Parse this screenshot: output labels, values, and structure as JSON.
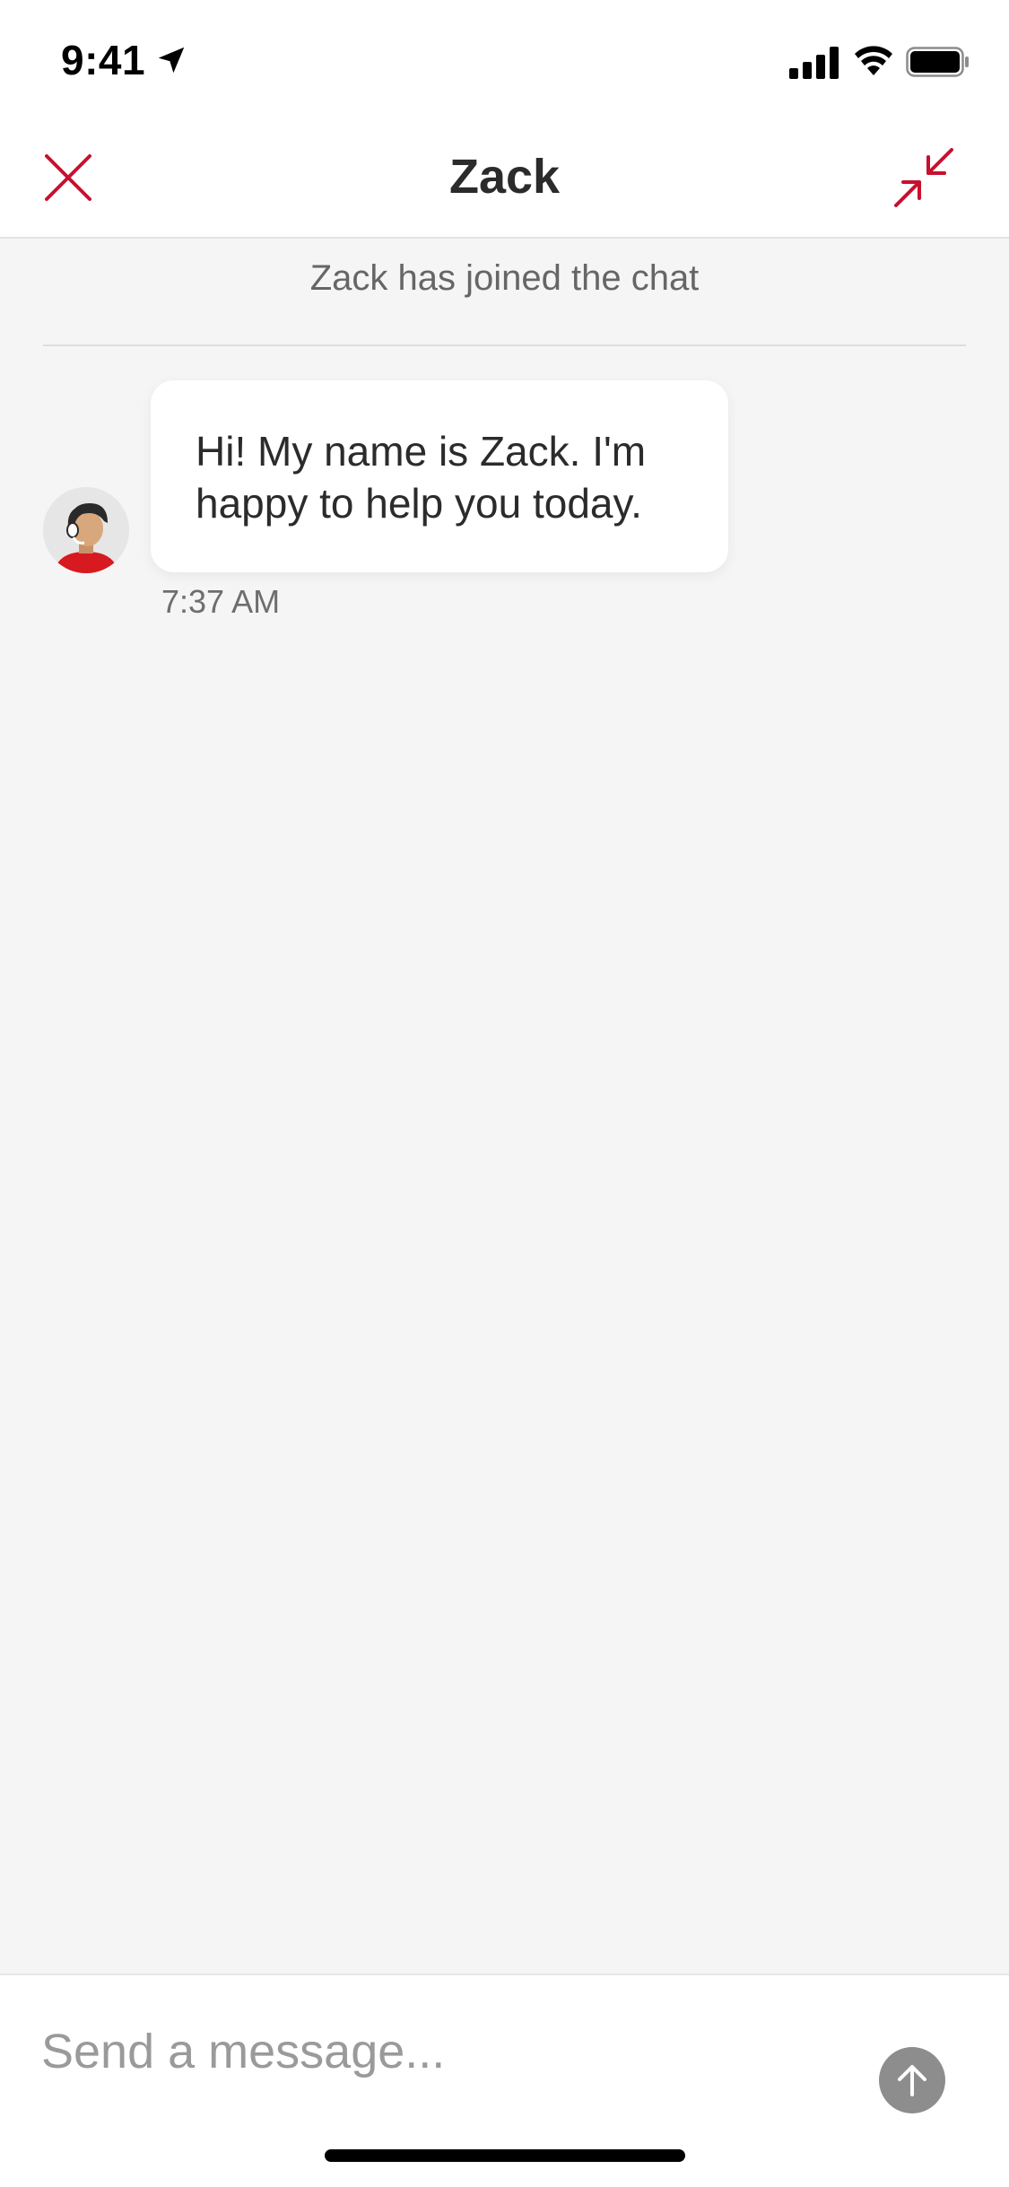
{
  "status_bar": {
    "time": "9:41"
  },
  "header": {
    "title": "Zack"
  },
  "chat": {
    "system_message": "Zack has joined the chat",
    "messages": [
      {
        "text": "Hi! My name is Zack. I'm happy to help you today.",
        "time": "7:37 AM"
      }
    ]
  },
  "composer": {
    "placeholder": "Send a message..."
  },
  "colors": {
    "accent": "#c8102e",
    "background": "#f5f5f5",
    "send_button": "#8d8d8d"
  },
  "icons": {
    "close": "close-icon",
    "minimize": "minimize-icon",
    "send": "arrow-up-icon",
    "avatar": "agent-avatar"
  }
}
